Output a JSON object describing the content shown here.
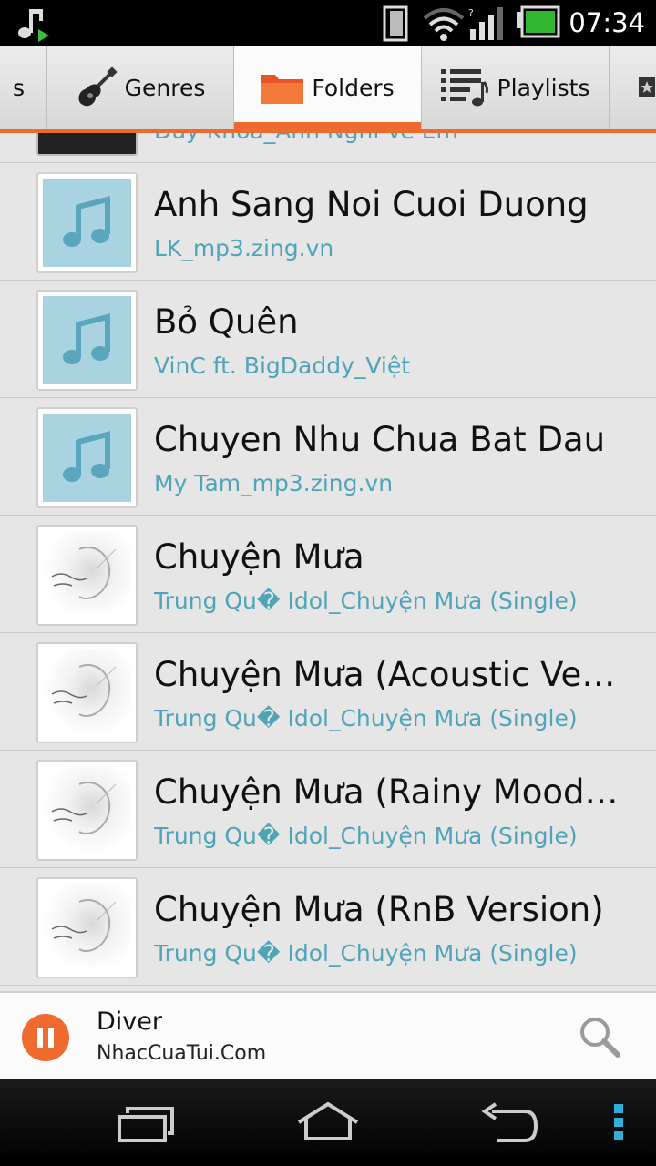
{
  "status_bar": {
    "time": "07:34",
    "icons": [
      "music-note-icon",
      "sim-icon",
      "wifi-icon",
      "signal-icon",
      "battery-icon"
    ]
  },
  "tabs": [
    {
      "label": "s",
      "icon": "artist-icon",
      "active": false
    },
    {
      "label": "Genres",
      "icon": "guitar-icon",
      "active": false
    },
    {
      "label": "Folders",
      "icon": "folder-icon",
      "active": true
    },
    {
      "label": "Playlists",
      "icon": "playlist-icon",
      "active": false
    },
    {
      "label": "",
      "icon": "star-icon",
      "active": false
    }
  ],
  "list": {
    "partial_top": {
      "subtitle": "Duy Khoa_Anh Nghi Ve Em"
    },
    "items": [
      {
        "title": "Anh Sang Noi Cuoi Duong",
        "subtitle": "LK_mp3.zing.vn",
        "art": "music-note"
      },
      {
        "title": "Bỏ Quên",
        "subtitle": "VinC ft. BigDaddy_Việt",
        "art": "music-note"
      },
      {
        "title": "Chuyen Nhu Chua Bat Dau",
        "subtitle": "My Tam_mp3.zing.vn",
        "art": "music-note"
      },
      {
        "title": "Chuyện Mưa",
        "subtitle": "Trung Qu� Idol_Chuyện Mưa (Single)",
        "art": "album"
      },
      {
        "title": "Chuyện Mưa (Acoustic Ver…",
        "subtitle": "Trung Qu� Idol_Chuyện Mưa (Single)",
        "art": "album"
      },
      {
        "title": "Chuyện Mưa (Rainy Mood …",
        "subtitle": "Trung Qu� Idol_Chuyện Mưa (Single)",
        "art": "album"
      },
      {
        "title": "Chuyện Mưa (RnB Version)",
        "subtitle": "Trung Qu� Idol_Chuyện Mưa (Single)",
        "art": "album"
      }
    ]
  },
  "now_playing": {
    "title": "Diver",
    "artist": "NhacCuaTui.Com",
    "state": "playing"
  },
  "colors": {
    "accent": "#ef6a2e",
    "subtitle": "#4fa4b8",
    "note_bg": "#a9d3e1"
  }
}
